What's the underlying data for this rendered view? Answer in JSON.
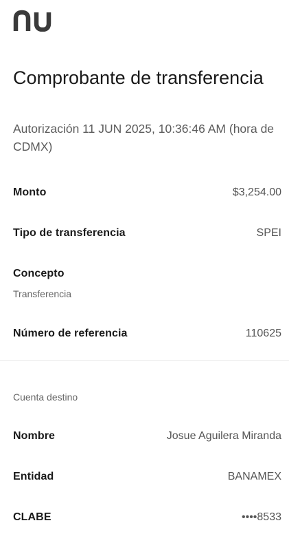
{
  "brand": {
    "logo_text": "nu",
    "color": "#3a3a3a"
  },
  "header": {
    "title": "Comprobante de transferencia",
    "subtitle": "Autorización 11 JUN 2025, 10:36:46 AM (hora de CDMX)"
  },
  "details": {
    "monto": {
      "label": "Monto",
      "value": "$3,254.00"
    },
    "tipo": {
      "label": "Tipo de transferencia",
      "value": "SPEI"
    },
    "concepto": {
      "label": "Concepto",
      "value": "Transferencia"
    },
    "referencia": {
      "label": "Número de referencia",
      "value": "110625"
    }
  },
  "destino": {
    "section_label": "Cuenta destino",
    "nombre": {
      "label": "Nombre",
      "value": "Josue Aguilera Miranda"
    },
    "entidad": {
      "label": "Entidad",
      "value": "BANAMEX"
    },
    "clabe": {
      "label": "CLABE",
      "value": "••••8533"
    }
  }
}
